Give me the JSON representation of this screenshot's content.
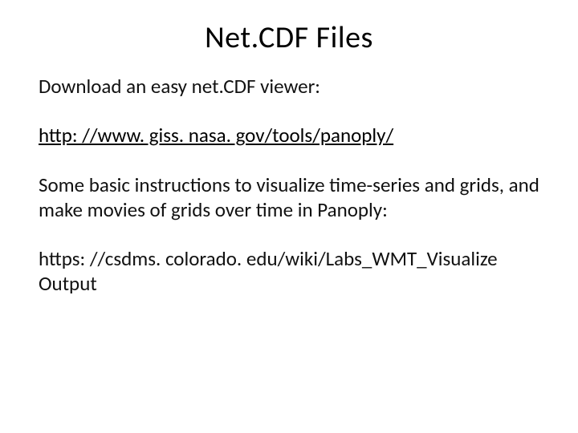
{
  "title": "Net.CDF Files",
  "intro": "Download an easy net.CDF viewer:",
  "link1": "http: //www. giss. nasa. gov/tools/panoply/",
  "instructions": "Some basic instructions to visualize time-series and grids, and make movies of grids over time in Panoply:",
  "link2": "https: //csdms. colorado. edu/wiki/Labs_WMT_Visualize Output"
}
